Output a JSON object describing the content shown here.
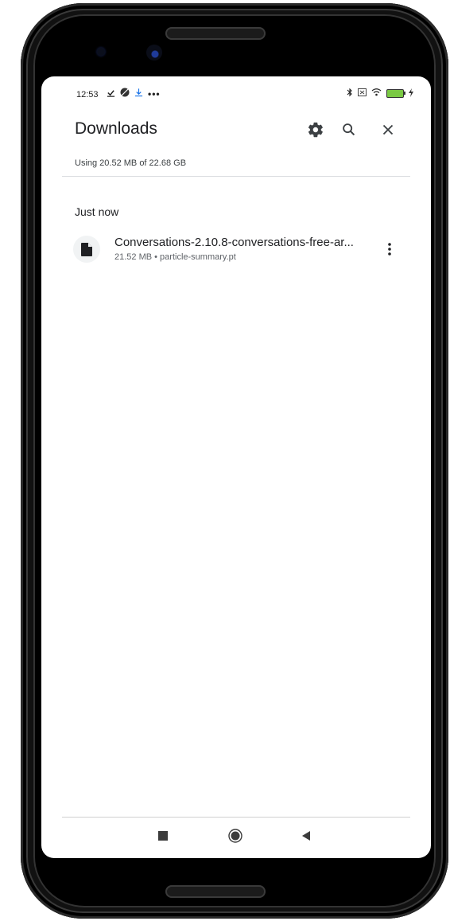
{
  "status_bar": {
    "time": "12:53",
    "left_icons": [
      "download-done-icon",
      "dnd-icon",
      "download-icon",
      "more-dots-icon"
    ],
    "right_icons": [
      "bluetooth-icon",
      "no-sim-icon",
      "wifi-icon",
      "battery-icon",
      "charging-icon"
    ]
  },
  "header": {
    "title": "Downloads",
    "settings_icon": "gear-icon",
    "search_icon": "search-icon",
    "close_icon": "close-icon"
  },
  "storage": {
    "text": "Using 20.52 MB of 22.68 GB"
  },
  "sections": [
    {
      "label": "Just now",
      "items": [
        {
          "name": "Conversations-2.10.8-conversations-free-ar...",
          "meta": "21.52 MB • particle-summary.pt",
          "icon": "file-icon"
        }
      ]
    }
  ],
  "nav_bar": {
    "recent": "square-icon",
    "home": "circle-icon",
    "back": "back-triangle-icon"
  },
  "colors": {
    "battery": "#7ac943",
    "download_accent": "#1a73e8"
  }
}
